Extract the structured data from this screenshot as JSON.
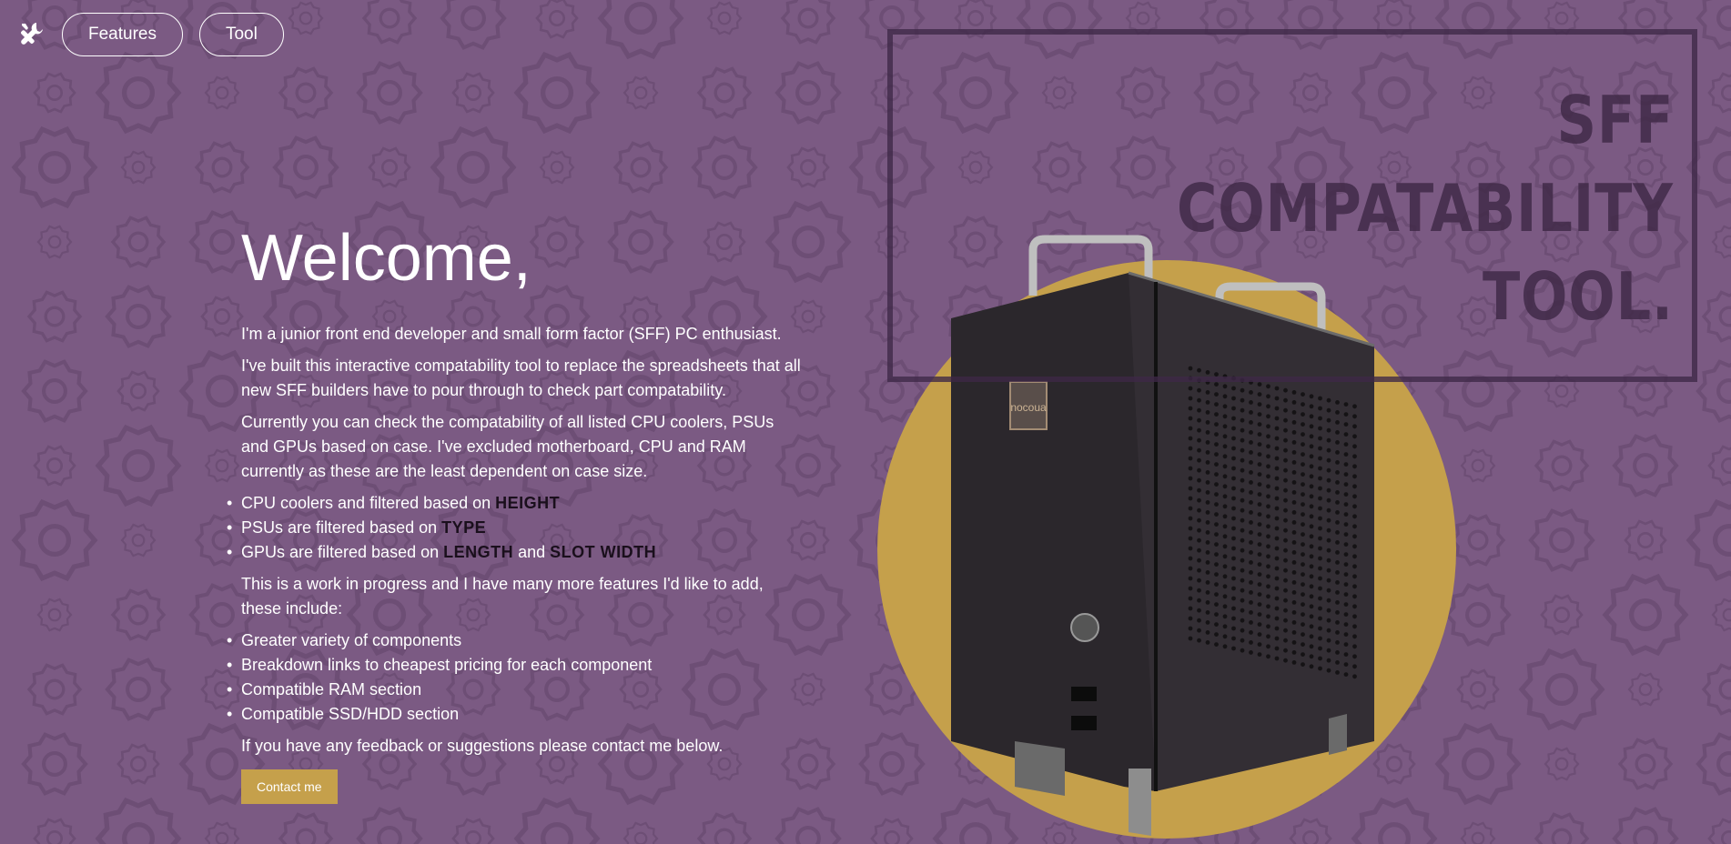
{
  "nav": {
    "logo_icon": "tools-icon",
    "features_label": "Features",
    "tool_label": "Tool"
  },
  "hero": {
    "title_line1": "SFF",
    "title_line2": "COMPATABILITY",
    "title_line3": "TOOL."
  },
  "main": {
    "heading": "Welcome,",
    "intro": "I'm a junior front end developer and small form factor (SFF) PC enthusiast.",
    "para2": "I've built this interactive compatability tool to replace the spreadsheets that all new SFF builders have to pour through to check part compatability.",
    "para3": "Currently you can check the compatability of all listed CPU coolers, PSUs and GPUs based on case. I've excluded motherboard, CPU and RAM currently as these are the least dependent on case size.",
    "filters": {
      "cpu_text": "CPU coolers and filtered based on ",
      "cpu_hl": "HEIGHT",
      "psu_text": "PSUs are filtered based on ",
      "psu_hl": "TYPE",
      "gpu_text": "GPUs are filtered based on ",
      "gpu_hl1": "LENGTH",
      "gpu_and": " and ",
      "gpu_hl2": "SLOT WIDTH"
    },
    "para4": "This is a work in progress and I have many more features I'd like to add, these include:",
    "planned": [
      "Greater variety of components",
      "Breakdown links to cheapest pricing for each component",
      "Compatible RAM section",
      "Compatible SSD/HDD section"
    ],
    "para5": "If you have any feedback or suggestions please contact me below.",
    "contact_label": "Contact me"
  },
  "image": {
    "case_badge": "nocoua"
  },
  "colors": {
    "background": "#7b5a83",
    "accent": "#c5a04b",
    "title_dark": "#3e2846"
  }
}
